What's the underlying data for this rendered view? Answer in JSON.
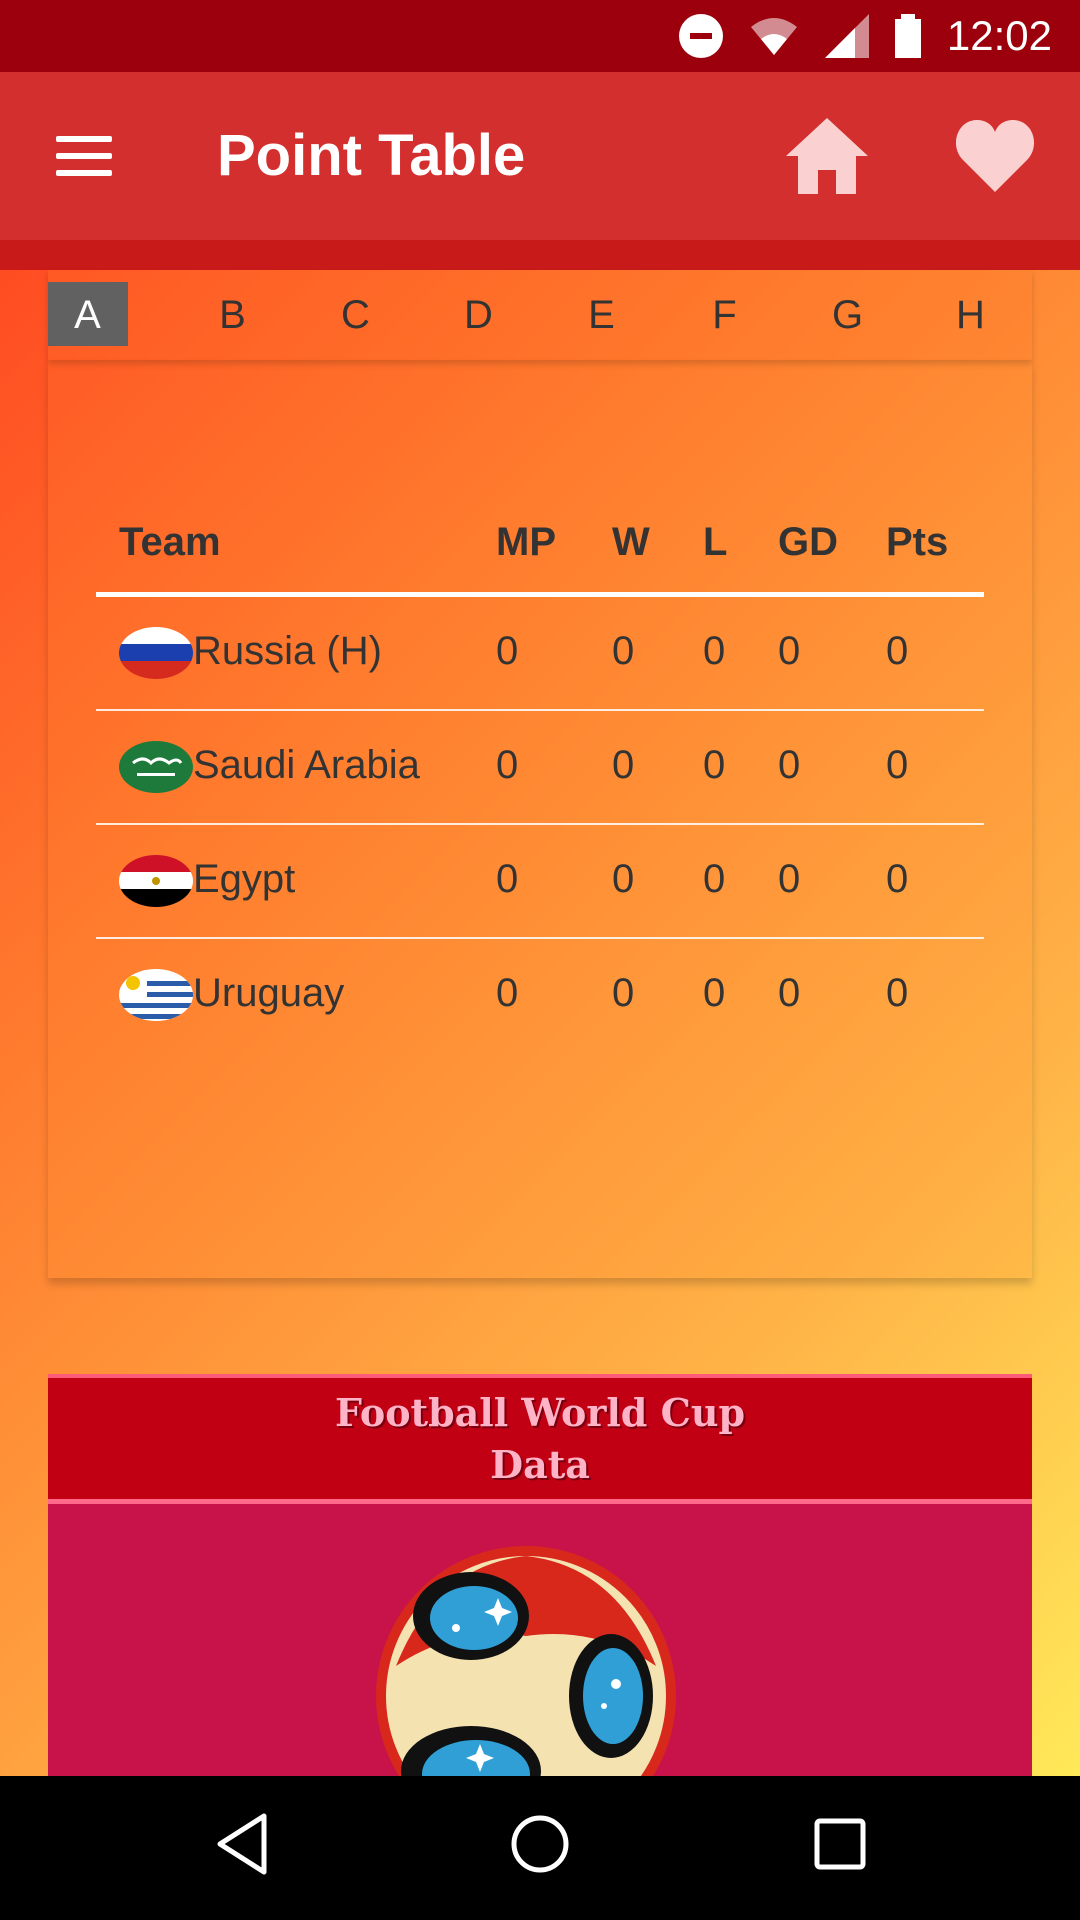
{
  "status_bar": {
    "time": "12:02"
  },
  "app_bar": {
    "title": "Point Table"
  },
  "tabs": [
    "A",
    "B",
    "C",
    "D",
    "E",
    "F",
    "G",
    "H"
  ],
  "table": {
    "headers": {
      "team": "Team",
      "mp": "MP",
      "w": "W",
      "l": "L",
      "gd": "GD",
      "pts": "Pts"
    },
    "rows": [
      {
        "team": "Russia (H)",
        "mp": "0",
        "w": "0",
        "l": "0",
        "gd": "0",
        "pts": "0"
      },
      {
        "team": "Saudi Arabia",
        "mp": "0",
        "w": "0",
        "l": "0",
        "gd": "0",
        "pts": "0"
      },
      {
        "team": "Egypt",
        "mp": "0",
        "w": "0",
        "l": "0",
        "gd": "0",
        "pts": "0"
      },
      {
        "team": "Uruguay",
        "mp": "0",
        "w": "0",
        "l": "0",
        "gd": "0",
        "pts": "0"
      }
    ]
  },
  "banner": {
    "title": "Football World Cup Data"
  },
  "colors": {
    "status_bar": "#9c000c",
    "app_bar": "#d32f2f",
    "active_tab": "#616161",
    "banner_header": "#c20014",
    "banner_body": "#c8134a"
  }
}
